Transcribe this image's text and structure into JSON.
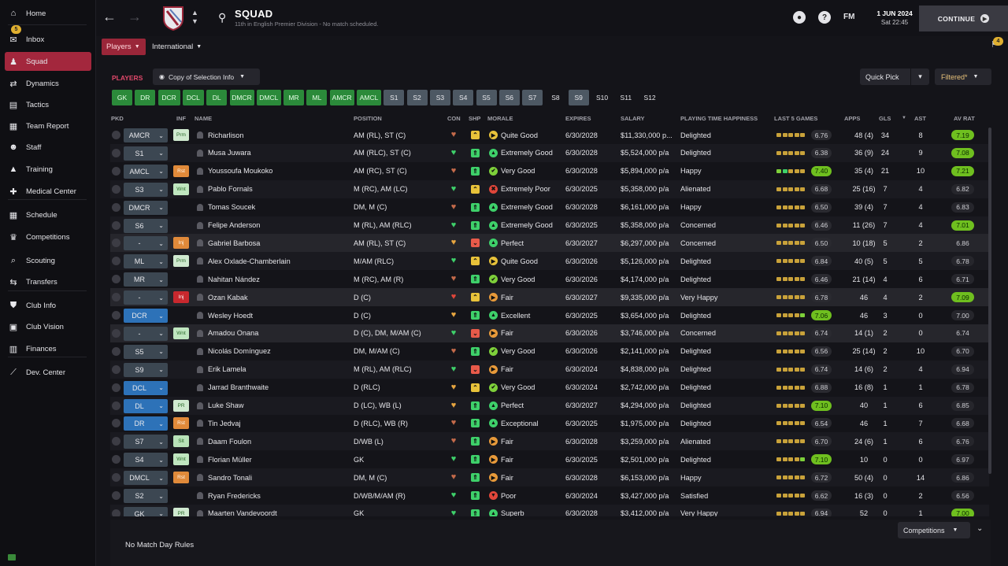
{
  "sidebar": {
    "items": [
      {
        "label": "Home",
        "icon": "home-icon",
        "glyph": "⌂"
      },
      {
        "label": "Inbox",
        "icon": "inbox-icon",
        "glyph": "✉",
        "badge": "5"
      },
      {
        "label": "Squad",
        "icon": "shirt-icon",
        "glyph": "♟",
        "active": true
      },
      {
        "label": "Dynamics",
        "icon": "dynamics-icon",
        "glyph": "⇄"
      },
      {
        "label": "Tactics",
        "icon": "tactics-icon",
        "glyph": "▤"
      },
      {
        "label": "Team Report",
        "icon": "report-icon",
        "glyph": "▦"
      },
      {
        "label": "Staff",
        "icon": "staff-icon",
        "glyph": "☻"
      },
      {
        "label": "Training",
        "icon": "training-icon",
        "glyph": "▲"
      },
      {
        "label": "Medical Center",
        "icon": "medical-icon",
        "glyph": "✚"
      },
      {
        "label": "Schedule",
        "icon": "calendar-icon",
        "glyph": "▦"
      },
      {
        "label": "Competitions",
        "icon": "trophy-icon",
        "glyph": "♛"
      },
      {
        "label": "Scouting",
        "icon": "scouting-icon",
        "glyph": "⌕"
      },
      {
        "label": "Transfers",
        "icon": "transfers-icon",
        "glyph": "⇆"
      },
      {
        "label": "Club Info",
        "icon": "shield-icon",
        "glyph": "⛊"
      },
      {
        "label": "Club Vision",
        "icon": "vision-icon",
        "glyph": "▣"
      },
      {
        "label": "Finances",
        "icon": "finances-icon",
        "glyph": "▥"
      },
      {
        "label": "Dev. Center",
        "icon": "dev-center-icon",
        "glyph": "⟋"
      }
    ]
  },
  "header": {
    "title": "SQUAD",
    "subtitle": "11th in English Premier Division - No match scheduled.",
    "fm": "FM",
    "date": "1 JUN 2024",
    "time": "Sat 22:45",
    "continue": "CONTINUE"
  },
  "subtabs": {
    "players": "Players",
    "international": "International"
  },
  "panel": {
    "label": "PLAYERS",
    "copy_selection": "Copy of Selection Info",
    "quick_pick": "Quick Pick",
    "filtered": "Filtered*"
  },
  "positions": [
    {
      "label": "GK",
      "style": "green"
    },
    {
      "label": "DR",
      "style": "green"
    },
    {
      "label": "DCR",
      "style": "green"
    },
    {
      "label": "DCL",
      "style": "green"
    },
    {
      "label": "DL",
      "style": "green"
    },
    {
      "label": "DMCR",
      "style": "green"
    },
    {
      "label": "DMCL",
      "style": "green"
    },
    {
      "label": "MR",
      "style": "green"
    },
    {
      "label": "ML",
      "style": "green"
    },
    {
      "label": "AMCR",
      "style": "green"
    },
    {
      "label": "AMCL",
      "style": "green"
    },
    {
      "label": "S1",
      "style": "grey"
    },
    {
      "label": "S2",
      "style": "grey"
    },
    {
      "label": "S3",
      "style": "grey"
    },
    {
      "label": "S4",
      "style": "grey"
    },
    {
      "label": "S5",
      "style": "grey"
    },
    {
      "label": "S6",
      "style": "grey"
    },
    {
      "label": "S7",
      "style": "grey"
    },
    {
      "label": "S8",
      "style": "plain"
    },
    {
      "label": "S9",
      "style": "grey"
    },
    {
      "label": "S10",
      "style": "plain"
    },
    {
      "label": "S11",
      "style": "plain"
    },
    {
      "label": "S12",
      "style": "plain"
    }
  ],
  "columns": [
    "PKD",
    "INF",
    "NAME",
    "POSITION",
    "CON",
    "SHP",
    "MORALE",
    "EXPIRES",
    "SALARY",
    "PLAYING TIME HAPPINESS",
    "LAST 5 GAMES",
    "APPS",
    "GLS",
    "AST",
    "AV RAT"
  ],
  "players": [
    {
      "pkd": "AMCR",
      "pkd_style": "grey",
      "inf": "Prm",
      "inf_style": "prm",
      "name": "Richarlison",
      "position": "AM (RL), ST (C)",
      "con": "brown",
      "shp": "up",
      "morale": "Quite Good",
      "mor": "good",
      "expires": "6/30/2028",
      "salary": "$11,330,000 p...",
      "pth": "Delighted",
      "form": [
        3,
        3,
        3,
        3,
        3
      ],
      "avg": "6.76",
      "avg_good": false,
      "apps": "48 (4)",
      "gls": "34",
      "ast": "8",
      "avr": "7.19",
      "avr_good": true
    },
    {
      "pkd": "S1",
      "pkd_style": "grey",
      "inf": "",
      "inf_style": "",
      "name": "Musa Juwara",
      "position": "AM (RLC), ST (C)",
      "con": "green",
      "shp": "up2",
      "morale": "Extremely Good",
      "mor": "xgood",
      "expires": "6/30/2028",
      "salary": "$5,524,000 p/a",
      "pth": "Delighted",
      "form": [
        3,
        3,
        3,
        3,
        3
      ],
      "avg": "6.38",
      "avg_good": false,
      "apps": "36 (9)",
      "gls": "24",
      "ast": "9",
      "avr": "7.08",
      "avr_good": true
    },
    {
      "pkd": "AMCL",
      "pkd_style": "grey",
      "inf": "Rst",
      "inf_style": "rst",
      "name": "Youssoufa Moukoko",
      "position": "AM (RC), ST (C)",
      "con": "brown",
      "shp": "up2",
      "morale": "Very Good",
      "mor": "vgood",
      "expires": "6/30/2028",
      "salary": "$5,894,000 p/a",
      "pth": "Happy",
      "form": [
        2,
        1,
        3,
        3,
        3
      ],
      "avg": "7.40",
      "avg_good": true,
      "apps": "35 (4)",
      "gls": "21",
      "ast": "10",
      "avr": "7.21",
      "avr_good": true
    },
    {
      "pkd": "S3",
      "pkd_style": "grey",
      "inf": "Wnt",
      "inf_style": "wnt",
      "name": "Pablo Fornals",
      "position": "M (RC), AM (LC)",
      "con": "green",
      "shp": "up",
      "morale": "Extremely Poor",
      "mor": "xpoor",
      "expires": "6/30/2025",
      "salary": "$5,358,000 p/a",
      "pth": "Alienated",
      "form": [
        3,
        3,
        3,
        3,
        3
      ],
      "avg": "6.68",
      "avg_good": false,
      "apps": "25 (16)",
      "gls": "7",
      "ast": "4",
      "avr": "6.82",
      "avr_good": false
    },
    {
      "pkd": "DMCR",
      "pkd_style": "grey",
      "inf": "",
      "inf_style": "",
      "name": "Tomas Soucek",
      "position": "DM, M (C)",
      "con": "brown",
      "shp": "up2",
      "morale": "Extremely Good",
      "mor": "xgood",
      "expires": "6/30/2028",
      "salary": "$6,161,000 p/a",
      "pth": "Happy",
      "form": [
        3,
        3,
        3,
        3,
        3
      ],
      "avg": "6.50",
      "avg_good": false,
      "apps": "39 (4)",
      "gls": "7",
      "ast": "4",
      "avr": "6.83",
      "avr_good": false
    },
    {
      "pkd": "S6",
      "pkd_style": "grey",
      "inf": "",
      "inf_style": "",
      "name": "Felipe Anderson",
      "position": "M (RL), AM (RLC)",
      "con": "green",
      "shp": "up2",
      "morale": "Extremely Good",
      "mor": "xgood",
      "expires": "6/30/2025",
      "salary": "$5,358,000 p/a",
      "pth": "Concerned",
      "form": [
        3,
        3,
        3,
        3,
        3
      ],
      "avg": "6.46",
      "avg_good": false,
      "apps": "11 (26)",
      "gls": "7",
      "ast": "4",
      "avr": "7.01",
      "avr_good": true
    },
    {
      "pkd": "-",
      "pkd_style": "grey",
      "inf": "Inj",
      "inf_style": "inj",
      "name": "Gabriel Barbosa",
      "position": "AM (RL), ST (C)",
      "con": "orange",
      "shp": "down",
      "morale": "Perfect",
      "mor": "perfect",
      "expires": "6/30/2027",
      "salary": "$6,297,000 p/a",
      "pth": "Concerned",
      "form": [
        3,
        3,
        3,
        3,
        3
      ],
      "avg": "6.50",
      "avg_good": false,
      "apps": "10 (18)",
      "gls": "5",
      "ast": "2",
      "avr": "6.86",
      "avr_good": false
    },
    {
      "pkd": "ML",
      "pkd_style": "grey",
      "inf": "Prm",
      "inf_style": "prm",
      "name": "Alex Oxlade-Chamberlain",
      "position": "M/AM (RLC)",
      "con": "green",
      "shp": "up",
      "morale": "Quite Good",
      "mor": "good",
      "expires": "6/30/2026",
      "salary": "$5,126,000 p/a",
      "pth": "Delighted",
      "form": [
        3,
        3,
        3,
        3,
        3
      ],
      "avg": "6.84",
      "avg_good": false,
      "apps": "40 (5)",
      "gls": "5",
      "ast": "5",
      "avr": "6.78",
      "avr_good": false
    },
    {
      "pkd": "MR",
      "pkd_style": "grey",
      "inf": "",
      "inf_style": "",
      "name": "Nahitan Nández",
      "position": "M (RC), AM (R)",
      "con": "brown",
      "shp": "up2",
      "morale": "Very Good",
      "mor": "vgood",
      "expires": "6/30/2026",
      "salary": "$4,174,000 p/a",
      "pth": "Delighted",
      "form": [
        3,
        3,
        3,
        3,
        3
      ],
      "avg": "6.46",
      "avg_good": false,
      "apps": "21 (14)",
      "gls": "4",
      "ast": "6",
      "avr": "6.71",
      "avr_good": false
    },
    {
      "pkd": "-",
      "pkd_style": "grey",
      "inf": "Inj",
      "inf_style": "inj red",
      "name": "Ozan Kabak",
      "position": "D (C)",
      "con": "red",
      "shp": "up",
      "morale": "Fair",
      "mor": "fair",
      "expires": "6/30/2027",
      "salary": "$9,335,000 p/a",
      "pth": "Very Happy",
      "form": [
        3,
        3,
        3,
        3,
        3
      ],
      "avg": "6.78",
      "avg_good": false,
      "apps": "46",
      "gls": "4",
      "ast": "2",
      "avr": "7.09",
      "avr_good": true
    },
    {
      "pkd": "DCR",
      "pkd_style": "blue",
      "inf": "",
      "inf_style": "",
      "name": "Wesley Hoedt",
      "position": "D (C)",
      "con": "orange",
      "shp": "up2",
      "morale": "Excellent",
      "mor": "excellent",
      "expires": "6/30/2025",
      "salary": "$3,654,000 p/a",
      "pth": "Delighted",
      "form": [
        3,
        3,
        3,
        3,
        2
      ],
      "avg": "7.06",
      "avg_good": true,
      "apps": "46",
      "gls": "3",
      "ast": "0",
      "avr": "7.00",
      "avr_good": false
    },
    {
      "pkd": "-",
      "pkd_style": "grey",
      "inf": "Wnt",
      "inf_style": "wnt",
      "name": "Amadou Onana",
      "position": "D (C), DM, M/AM (C)",
      "con": "green",
      "shp": "down",
      "morale": "Fair",
      "mor": "fair",
      "expires": "6/30/2026",
      "salary": "$3,746,000 p/a",
      "pth": "Concerned",
      "form": [
        3,
        3,
        3,
        3,
        3
      ],
      "avg": "6.74",
      "avg_good": false,
      "apps": "14 (1)",
      "gls": "2",
      "ast": "0",
      "avr": "6.74",
      "avr_good": false
    },
    {
      "pkd": "S5",
      "pkd_style": "grey",
      "inf": "",
      "inf_style": "",
      "name": "Nicolás Domínguez",
      "position": "DM, M/AM (C)",
      "con": "brown",
      "shp": "up2",
      "morale": "Very Good",
      "mor": "vgood",
      "expires": "6/30/2026",
      "salary": "$2,141,000 p/a",
      "pth": "Delighted",
      "form": [
        3,
        3,
        3,
        3,
        3
      ],
      "avg": "6.56",
      "avg_good": false,
      "apps": "25 (14)",
      "gls": "2",
      "ast": "10",
      "avr": "6.70",
      "avr_good": false
    },
    {
      "pkd": "S9",
      "pkd_style": "grey",
      "inf": "",
      "inf_style": "",
      "name": "Erik Lamela",
      "position": "M (RL), AM (RLC)",
      "con": "green",
      "shp": "down",
      "morale": "Fair",
      "mor": "fair",
      "expires": "6/30/2024",
      "salary": "$4,838,000 p/a",
      "pth": "Delighted",
      "form": [
        3,
        3,
        3,
        3,
        3
      ],
      "avg": "6.74",
      "avg_good": false,
      "apps": "14 (6)",
      "gls": "2",
      "ast": "4",
      "avr": "6.94",
      "avr_good": false
    },
    {
      "pkd": "DCL",
      "pkd_style": "blue",
      "inf": "",
      "inf_style": "",
      "name": "Jarrad Branthwaite",
      "position": "D (RLC)",
      "con": "orange",
      "shp": "up",
      "morale": "Very Good",
      "mor": "vgood",
      "expires": "6/30/2024",
      "salary": "$2,742,000 p/a",
      "pth": "Delighted",
      "form": [
        3,
        3,
        3,
        3,
        3
      ],
      "avg": "6.88",
      "avg_good": false,
      "apps": "16 (8)",
      "gls": "1",
      "ast": "1",
      "avr": "6.78",
      "avr_good": false
    },
    {
      "pkd": "DL",
      "pkd_style": "blue",
      "inf": "PR",
      "inf_style": "pr",
      "name": "Luke Shaw",
      "position": "D (LC), WB (L)",
      "con": "orange",
      "shp": "up2",
      "morale": "Perfect",
      "mor": "perfect",
      "expires": "6/30/2027",
      "salary": "$4,294,000 p/a",
      "pth": "Delighted",
      "form": [
        3,
        3,
        3,
        3,
        3
      ],
      "avg": "7.10",
      "avg_good": true,
      "apps": "40",
      "gls": "1",
      "ast": "6",
      "avr": "6.85",
      "avr_good": false
    },
    {
      "pkd": "DR",
      "pkd_style": "blue",
      "inf": "Rst",
      "inf_style": "rst",
      "name": "Tin Jedvaj",
      "position": "D (RLC), WB (R)",
      "con": "brown",
      "shp": "up2",
      "morale": "Exceptional",
      "mor": "exceptional",
      "expires": "6/30/2025",
      "salary": "$1,975,000 p/a",
      "pth": "Delighted",
      "form": [
        3,
        3,
        3,
        3,
        3
      ],
      "avg": "6.54",
      "avg_good": false,
      "apps": "46",
      "gls": "1",
      "ast": "7",
      "avr": "6.68",
      "avr_good": false
    },
    {
      "pkd": "S7",
      "pkd_style": "grey",
      "inf": "Slt",
      "inf_style": "slt",
      "name": "Daam Foulon",
      "position": "D/WB (L)",
      "con": "brown",
      "shp": "up2",
      "morale": "Fair",
      "mor": "fair",
      "expires": "6/30/2028",
      "salary": "$3,259,000 p/a",
      "pth": "Alienated",
      "form": [
        3,
        3,
        3,
        3,
        3
      ],
      "avg": "6.70",
      "avg_good": false,
      "apps": "24 (6)",
      "gls": "1",
      "ast": "6",
      "avr": "6.76",
      "avr_good": false
    },
    {
      "pkd": "S4",
      "pkd_style": "grey",
      "inf": "Wnt",
      "inf_style": "wnt",
      "name": "Florian Müller",
      "position": "GK",
      "con": "green",
      "shp": "up2",
      "morale": "Fair",
      "mor": "fair",
      "expires": "6/30/2025",
      "salary": "$2,501,000 p/a",
      "pth": "Delighted",
      "form": [
        3,
        3,
        3,
        3,
        2
      ],
      "avg": "7.10",
      "avg_good": true,
      "apps": "10",
      "gls": "0",
      "ast": "0",
      "avr": "6.97",
      "avr_good": false
    },
    {
      "pkd": "DMCL",
      "pkd_style": "grey",
      "inf": "Rst",
      "inf_style": "rst",
      "name": "Sandro Tonali",
      "position": "DM, M (C)",
      "con": "brown",
      "shp": "up2",
      "morale": "Fair",
      "mor": "fair",
      "expires": "6/30/2028",
      "salary": "$6,153,000 p/a",
      "pth": "Happy",
      "form": [
        3,
        3,
        3,
        3,
        3
      ],
      "avg": "6.72",
      "avg_good": false,
      "apps": "50 (4)",
      "gls": "0",
      "ast": "14",
      "avr": "6.86",
      "avr_good": false
    },
    {
      "pkd": "S2",
      "pkd_style": "grey",
      "inf": "",
      "inf_style": "",
      "name": "Ryan Fredericks",
      "position": "D/WB/M/AM (R)",
      "con": "green",
      "shp": "up2",
      "morale": "Poor",
      "mor": "poor",
      "expires": "6/30/2024",
      "salary": "$3,427,000 p/a",
      "pth": "Satisfied",
      "form": [
        3,
        3,
        3,
        3,
        3
      ],
      "avg": "6.62",
      "avg_good": false,
      "apps": "16 (3)",
      "gls": "0",
      "ast": "2",
      "avr": "6.56",
      "avr_good": false
    },
    {
      "pkd": "GK",
      "pkd_style": "grey",
      "inf": "PR",
      "inf_style": "pr",
      "name": "Maarten Vandevoordt",
      "position": "GK",
      "con": "green",
      "shp": "up2",
      "morale": "Superb",
      "mor": "excellent",
      "expires": "6/30/2028",
      "salary": "$3,412,000 p/a",
      "pth": "Very Happy",
      "form": [
        3,
        3,
        3,
        3,
        3
      ],
      "avg": "6.94",
      "avg_good": false,
      "apps": "52",
      "gls": "0",
      "ast": "1",
      "avr": "7.00",
      "avr_good": true
    }
  ],
  "footer": {
    "no_match": "No Match Day Rules",
    "competitions": "Competitions"
  },
  "colors": {
    "accent": "#a3273d",
    "green": "#2b8a3a",
    "rating_good": "#6fbf1f"
  }
}
